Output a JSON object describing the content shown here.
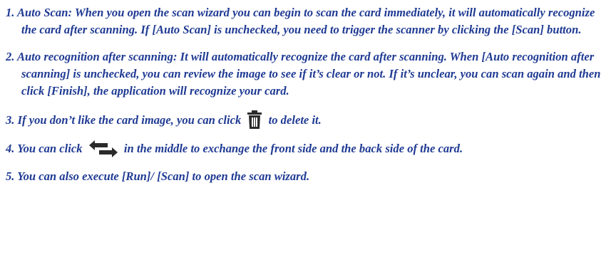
{
  "items": [
    {
      "text": "1. Auto Scan: When you open the scan wizard you can begin to scan the card immediately, it will automatically recognize the card after scanning. If [Auto Scan] is unchecked, you need to trigger the scanner by clicking the [Scan] button."
    },
    {
      "text": "2. Auto recognition after scanning: It will automatically recognize the card after scanning. When [Auto recognition after scanning] is unchecked, you can review the image to see if it’s clear or not. If it’s unclear, you can scan again and then click [Finish], the application will recognize your card."
    },
    {
      "before": "3. If you don’t like the card image, you can click",
      "icon": "trash-icon",
      "after": "to delete it."
    },
    {
      "before": "4. You can click",
      "icon": "swap-arrows-icon",
      "after": "in the middle to exchange the front side and the back side of the card."
    },
    {
      "text": "5. You can also execute [Run]/ [Scan] to open the scan wizard."
    }
  ],
  "colors": {
    "text": "#1f3a93",
    "icon_dark": "#2b2b2b"
  }
}
